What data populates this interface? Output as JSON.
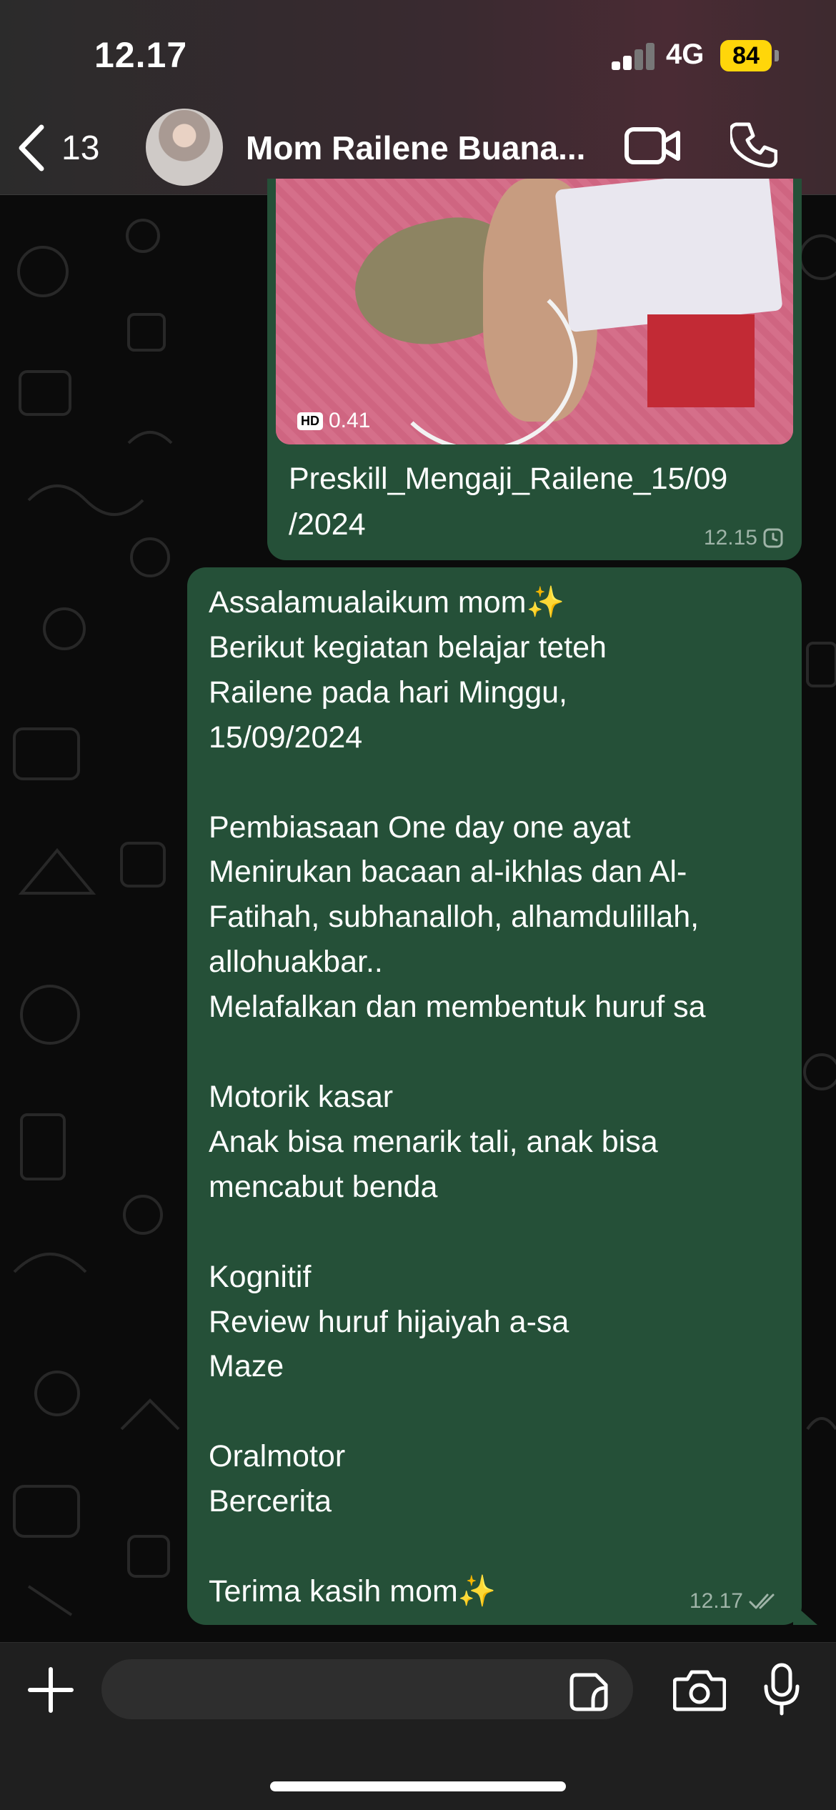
{
  "status_bar": {
    "time": "12.17",
    "network": "4G",
    "battery": "84"
  },
  "header": {
    "back_count": "13",
    "contact_name": "Mom Railene Buana...",
    "icons": {
      "back": "chevron-left-icon",
      "video": "video-call-icon",
      "phone": "phone-call-icon"
    }
  },
  "messages": [
    {
      "type": "video",
      "duration": "0.41",
      "quality_badge": "HD",
      "caption": "Preskill_Mengaji_Railene_15/09\n/2024",
      "time": "12.15",
      "status_icon": "clock-pending-icon"
    },
    {
      "type": "text",
      "text": "Assalamualaikum mom✨\nBerikut kegiatan belajar teteh\nRailene pada hari Minggu,\n15/09/2024\n\nPembiasaan One day one ayat\nMenirukan bacaan al-ikhlas dan Al-\nFatihah, subhanalloh, alhamdulillah,\nallohuakbar..\nMelafalkan dan membentuk huruf sa\n\nMotorik kasar\nAnak bisa menarik tali, anak bisa\nmencabut benda\n\nKognitif\nReview huruf hijaiyah a-sa\nMaze\n\nOralmotor\nBercerita\n\nTerima kasih mom✨",
      "time": "12.17",
      "status_icon": "double-check-icon"
    }
  ],
  "input_bar": {
    "placeholder": "",
    "icons": {
      "attach": "plus-icon",
      "sticker": "sticker-icon",
      "camera": "camera-icon",
      "mic": "microphone-icon"
    }
  },
  "colors": {
    "header_bg": "#3a2a30",
    "bubble_out": "#255038",
    "chat_bg": "#0b0b0b",
    "input_bar_bg": "#1f1f1f",
    "battery": "#ffd60a"
  }
}
